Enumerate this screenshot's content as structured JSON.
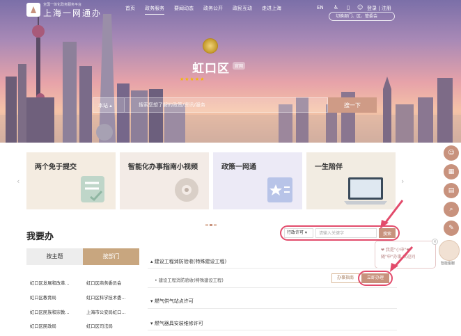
{
  "header": {
    "logo_subtitle": "全国一体化政务服务平台",
    "logo_title": "上海一网通办",
    "nav": [
      "首页",
      "政务服务",
      "要闻动态",
      "政务公开",
      "政民互动",
      "走进上海"
    ],
    "active_nav": "政务服务",
    "lang": "EN",
    "login": "登录 | 注册",
    "region_switch": "切换部门、区、管委会"
  },
  "hero": {
    "district": "虹口区",
    "badge": "官网",
    "rating_text": "",
    "search_scope": "本站",
    "search_placeholder": "搜索您想了解的政策/资讯/服务",
    "search_button": "搜一下"
  },
  "cards": [
    {
      "title": "两个免于提交"
    },
    {
      "title": "智能化办事指南小视频"
    },
    {
      "title": "政策一网通"
    },
    {
      "title": "一生陪伴"
    }
  ],
  "section": {
    "title": "我要办",
    "filter_select": "行政许可",
    "filter_placeholder": "请输入关键字",
    "filter_button": "搜索",
    "tabs": [
      "按主题",
      "按部门"
    ]
  },
  "departments": [
    "虹口区发展和改革…",
    "虹口区商务委员会",
    "虹口区教育局",
    "虹口区科学技术委…",
    "虹口区民族和宗教…",
    "上海市公安局虹口…",
    "虹口区民政局",
    "虹口区司法局"
  ],
  "items": [
    {
      "title": "建设工程消防验收(特殊建设工程)",
      "sub": "建设工程消防验收(特殊建设工程)"
    },
    {
      "title": "燃气供气站点许可"
    },
    {
      "title": "燃气器具安装维修许可"
    }
  ],
  "item_actions": {
    "guide": "办事指南",
    "handle": "立即办理"
  },
  "helper": {
    "bubble_line1": "❤ 我是\"小申\"❤",
    "bubble_line2": "随\"申\"办事 欢迎问",
    "label": "智能客服"
  },
  "colors": {
    "accent": "#c8927d",
    "highlight": "#e24b6b",
    "dept_tab": "#c8a67f"
  }
}
